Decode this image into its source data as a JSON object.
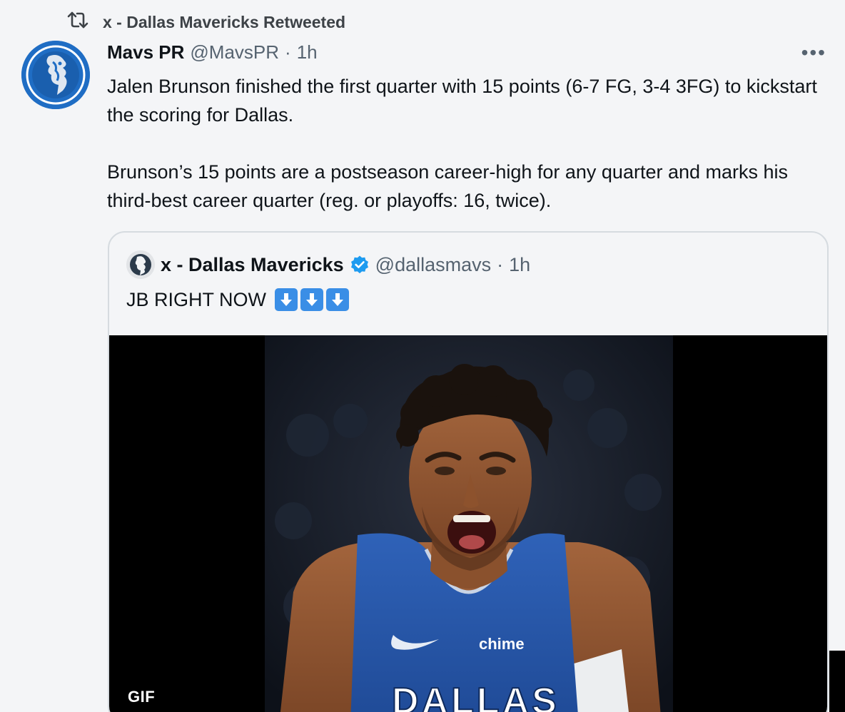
{
  "retweet": {
    "icon": "retweet-icon",
    "label": "x - Dallas Mavericks Retweeted"
  },
  "tweet": {
    "author_name": "Mavs PR",
    "author_handle": "@MavsPR",
    "separator": "·",
    "time": "1h",
    "more_label": "•••",
    "paragraphs": [
      "Jalen Brunson finished the first quarter with 15 points (6-7 FG, 3-4 3FG) to kickstart the scoring for Dallas.",
      "Brunson’s 15 points are a postseason career-high for any quarter and marks his third-best career quarter (reg. or playoffs: 16, twice)."
    ]
  },
  "quoted_tweet": {
    "author_name": "x - Dallas Mavericks",
    "verified": true,
    "author_handle": "@dallasmavs",
    "separator": "·",
    "time": "1h",
    "text": "JB RIGHT NOW",
    "emoji": [
      "down-arrow-icon",
      "down-arrow-icon",
      "down-arrow-icon"
    ],
    "media": {
      "type": "gif",
      "badge": "GIF",
      "jersey_sponsor": "chime",
      "jersey_text": "DALLAS"
    }
  },
  "colors": {
    "background": "#f4f5f7",
    "text": "#0f1419",
    "muted": "#566370",
    "verified": "#1d9bf0",
    "mavs_blue": "#1f6dc4",
    "arrow_emoji": "#3a8ee6",
    "border": "#d6dbe0"
  }
}
